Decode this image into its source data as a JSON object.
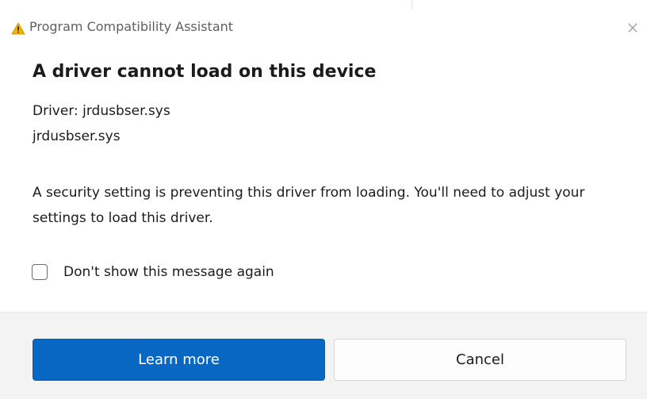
{
  "window": {
    "title": "Program Compatibility Assistant",
    "title_icon": "warning-triangle-icon",
    "close_icon": "close-icon",
    "close_glyph": "✕"
  },
  "dialog": {
    "heading": "A driver cannot load on this device",
    "driver_label_line": "Driver: jrdusbser.sys",
    "driver_file_line": "jrdusbser.sys",
    "message": "A security setting is preventing this driver from loading. You'll need to adjust your settings to load this driver.",
    "checkbox": {
      "label": "Don't show this message again",
      "checked": false
    }
  },
  "buttons": {
    "primary_label": "Learn more",
    "secondary_label": "Cancel"
  },
  "colors": {
    "accent": "#0767c2",
    "warning": "#f5b400",
    "footer_bg": "#f3f3f3"
  }
}
